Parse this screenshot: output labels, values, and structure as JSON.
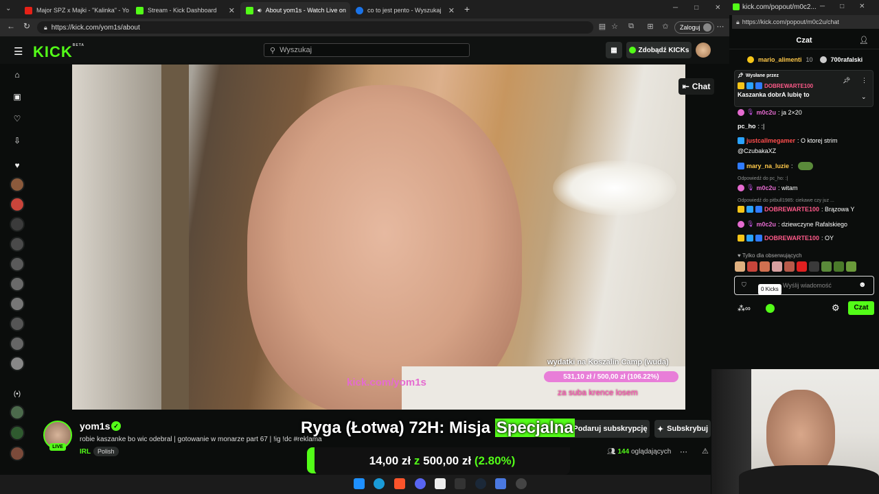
{
  "browser": {
    "tabs": [
      {
        "title": "Major SPZ x Majki - \"Kalinka\" - Yo",
        "favicon_color": "#e62117"
      },
      {
        "title": "Stream - Kick Dashboard",
        "favicon_color": "#53fc18"
      },
      {
        "title": "About yom1s - Watch Live on",
        "favicon_color": "#53fc18"
      },
      {
        "title": "co to jest pento - Wyszukaj",
        "favicon_color": "#1a73e8"
      }
    ],
    "url": "https://kick.com/yom1s/about",
    "login_label": "Zaloguj"
  },
  "kick": {
    "logo": "KICK",
    "logo_sup": "BETA",
    "search_placeholder": "Wyszukaj",
    "get_kicks_label": "Zdobądź KICKs",
    "chat_button": "Chat"
  },
  "video": {
    "url_overlay": "kick.com/yom1s",
    "goal_title": "wydatki na Koszalin Camp (wuda)",
    "goal_progress": "531,10 zł / 500,00 zł (106.22%)",
    "goal_sub": "za suba krence losem"
  },
  "stream": {
    "channel": "yom1s",
    "live_label": "LIVE",
    "title": "robie kaszanke bo wic odebral | gotowanie w monarze part 67 | !ig !dc #reklama",
    "category": "IRL",
    "tag": "Polish",
    "gift_sub_label": "Podaruj subskrypcję",
    "subscribe_label": "Subskrybuj",
    "viewers_count": "144",
    "viewers_label": "oglądających"
  },
  "overlay": {
    "title_before": "Ryga (Łotwa) 72H: Misja ",
    "title_highlight": "Specjalna",
    "goal_current": "14,00 zł",
    "goal_sep": "z",
    "goal_target": "500,00 zł",
    "goal_percent": "(2.80%)"
  },
  "popout": {
    "window_title": "kick.com/popout/m0c2...",
    "url": "https://kick.com/popout/m0c2u/chat",
    "header": "Czat",
    "top1_name": "mario_alimenti",
    "top1_count": "10",
    "top2_name": "700rafalski",
    "pinned_label": "Wysłane przez",
    "pinned_user": "DOBREWARTE100",
    "pinned_text": "Kaszanka dobrA lubię to",
    "messages": [
      {
        "user": "m0c2u",
        "text": ": ja 2×20",
        "color": "#e56bd0"
      },
      {
        "user": "pc_ho",
        "text": ": :|",
        "color": "#ffffff"
      },
      {
        "user": "justcallmegamer",
        "text": ": O ktorej strim",
        "color": "#ff4d4d"
      },
      {
        "user": "",
        "text": "@CzubakaXZ",
        "color": "#ffffff"
      },
      {
        "user": "mary_na_luzie",
        "text": ":",
        "color": "#ffc94a"
      },
      {
        "user": "m0c2u",
        "text": ": witam",
        "color": "#e56bd0"
      },
      {
        "user": "DOBREWARTE100",
        "text": ": Brązowa Y",
        "color": "#ff5a8a"
      },
      {
        "user": "m0c2u",
        "text": ": dziewczyne Rafalskiego",
        "color": "#e56bd0"
      },
      {
        "user": "DOBREWARTE100",
        "text": ": OY",
        "color": "#ff5a8a"
      }
    ],
    "reply1": "Odpowiedź do pc_ho: :|",
    "reply2": "Odpowiedź do pitbull1985: ciekawe czy juz ...",
    "followers_only": "Tylko dla obserwujących",
    "input_placeholder": "Wyślij wiadomość",
    "kicks_tooltip": "0 Kicks",
    "send_label": "Czat"
  }
}
